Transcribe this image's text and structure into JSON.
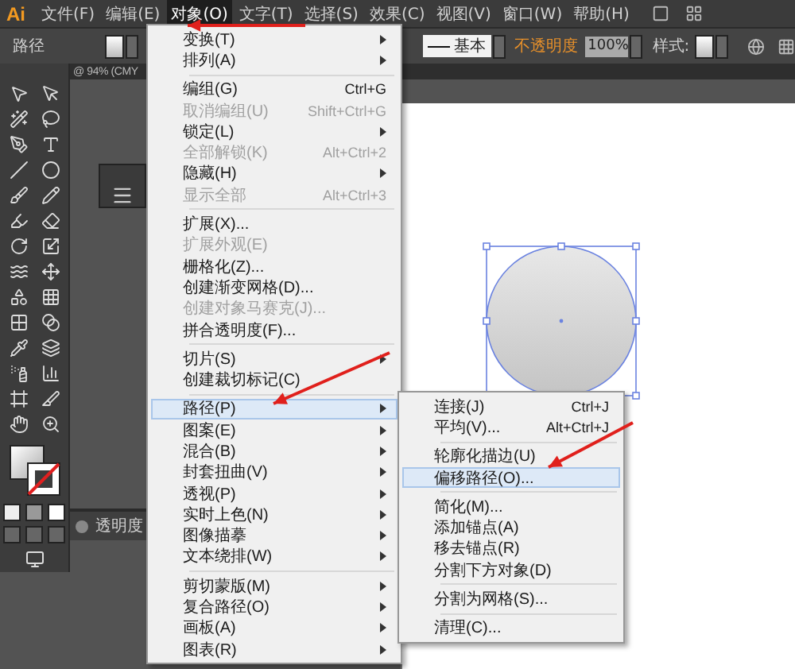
{
  "menubar": {
    "logo": "Ai",
    "items": [
      {
        "label": "文件(F)",
        "selected": false
      },
      {
        "label": "编辑(E)",
        "selected": false
      },
      {
        "label": "对象(O)",
        "selected": true
      },
      {
        "label": "文字(T)",
        "selected": false
      },
      {
        "label": "选择(S)",
        "selected": false
      },
      {
        "label": "效果(C)",
        "selected": false
      },
      {
        "label": "视图(V)",
        "selected": false
      },
      {
        "label": "窗口(W)",
        "selected": false
      },
      {
        "label": "帮助(H)",
        "selected": false
      }
    ]
  },
  "control_bar": {
    "object_type": "路径",
    "stroke_style": "基本",
    "opacity_label": "不透明度",
    "opacity_value": "100%",
    "style_label": "样式:"
  },
  "document_tab": {
    "title": "@ 94% (CMY"
  },
  "transparency_panel": {
    "title": "透明度"
  },
  "object_menu": {
    "items": [
      {
        "kind": "item",
        "label": "变换(T)",
        "submenu": true,
        "disabled": false,
        "selected": false
      },
      {
        "kind": "item",
        "label": "排列(A)",
        "submenu": true,
        "disabled": false,
        "selected": false
      },
      {
        "kind": "separator"
      },
      {
        "kind": "item",
        "label": "编组(G)",
        "shortcut": "Ctrl+G",
        "disabled": false,
        "selected": false
      },
      {
        "kind": "item",
        "label": "取消编组(U)",
        "shortcut": "Shift+Ctrl+G",
        "disabled": true,
        "selected": false
      },
      {
        "kind": "item",
        "label": "锁定(L)",
        "submenu": true,
        "disabled": false,
        "selected": false
      },
      {
        "kind": "item",
        "label": "全部解锁(K)",
        "shortcut": "Alt+Ctrl+2",
        "disabled": true,
        "selected": false
      },
      {
        "kind": "item",
        "label": "隐藏(H)",
        "submenu": true,
        "disabled": false,
        "selected": false
      },
      {
        "kind": "item",
        "label": "显示全部",
        "shortcut": "Alt+Ctrl+3",
        "disabled": true,
        "selected": false
      },
      {
        "kind": "separator"
      },
      {
        "kind": "item",
        "label": "扩展(X)...",
        "disabled": false,
        "selected": false
      },
      {
        "kind": "item",
        "label": "扩展外观(E)",
        "disabled": true,
        "selected": false
      },
      {
        "kind": "item",
        "label": "栅格化(Z)...",
        "disabled": false,
        "selected": false
      },
      {
        "kind": "item",
        "label": "创建渐变网格(D)...",
        "disabled": false,
        "selected": false
      },
      {
        "kind": "item",
        "label": "创建对象马赛克(J)...",
        "disabled": true,
        "selected": false
      },
      {
        "kind": "item",
        "label": "拼合透明度(F)...",
        "disabled": false,
        "selected": false
      },
      {
        "kind": "separator"
      },
      {
        "kind": "item",
        "label": "切片(S)",
        "submenu": true,
        "disabled": false,
        "selected": false
      },
      {
        "kind": "item",
        "label": "创建裁切标记(C)",
        "disabled": false,
        "selected": false
      },
      {
        "kind": "separator"
      },
      {
        "kind": "item",
        "label": "路径(P)",
        "submenu": true,
        "disabled": false,
        "selected": true
      },
      {
        "kind": "item",
        "label": "图案(E)",
        "submenu": true,
        "disabled": false,
        "selected": false
      },
      {
        "kind": "item",
        "label": "混合(B)",
        "submenu": true,
        "disabled": false,
        "selected": false
      },
      {
        "kind": "item",
        "label": "封套扭曲(V)",
        "submenu": true,
        "disabled": false,
        "selected": false
      },
      {
        "kind": "item",
        "label": "透视(P)",
        "submenu": true,
        "disabled": false,
        "selected": false
      },
      {
        "kind": "item",
        "label": "实时上色(N)",
        "submenu": true,
        "disabled": false,
        "selected": false
      },
      {
        "kind": "item",
        "label": "图像描摹",
        "submenu": true,
        "disabled": false,
        "selected": false
      },
      {
        "kind": "item",
        "label": "文本绕排(W)",
        "submenu": true,
        "disabled": false,
        "selected": false
      },
      {
        "kind": "separator"
      },
      {
        "kind": "item",
        "label": "剪切蒙版(M)",
        "submenu": true,
        "disabled": false,
        "selected": false
      },
      {
        "kind": "item",
        "label": "复合路径(O)",
        "submenu": true,
        "disabled": false,
        "selected": false
      },
      {
        "kind": "item",
        "label": "画板(A)",
        "submenu": true,
        "disabled": false,
        "selected": false
      },
      {
        "kind": "item",
        "label": "图表(R)",
        "submenu": true,
        "disabled": false,
        "selected": false
      }
    ]
  },
  "path_submenu": {
    "items": [
      {
        "kind": "item",
        "label": "连接(J)",
        "shortcut": "Ctrl+J",
        "disabled": false,
        "selected": false
      },
      {
        "kind": "item",
        "label": "平均(V)...",
        "shortcut": "Alt+Ctrl+J",
        "disabled": false,
        "selected": false
      },
      {
        "kind": "separator"
      },
      {
        "kind": "item",
        "label": "轮廓化描边(U)",
        "disabled": false,
        "selected": false
      },
      {
        "kind": "item",
        "label": "偏移路径(O)...",
        "disabled": false,
        "selected": true
      },
      {
        "kind": "separator"
      },
      {
        "kind": "item",
        "label": "简化(M)...",
        "disabled": false,
        "selected": false
      },
      {
        "kind": "item",
        "label": "添加锚点(A)",
        "disabled": false,
        "selected": false
      },
      {
        "kind": "item",
        "label": "移去锚点(R)",
        "disabled": false,
        "selected": false
      },
      {
        "kind": "item",
        "label": "分割下方对象(D)",
        "disabled": false,
        "selected": false
      },
      {
        "kind": "separator"
      },
      {
        "kind": "item",
        "label": "分割为网格(S)...",
        "disabled": false,
        "selected": false
      },
      {
        "kind": "separator"
      },
      {
        "kind": "item",
        "label": "清理(C)...",
        "disabled": false,
        "selected": false
      }
    ]
  }
}
